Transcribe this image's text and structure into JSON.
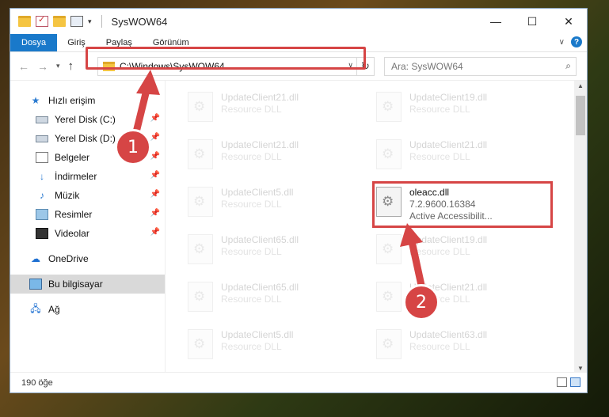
{
  "window": {
    "title": "SysWOW64"
  },
  "ribbon": {
    "tabs": [
      "Dosya",
      "Giriş",
      "Paylaş",
      "Görünüm"
    ],
    "help": "?"
  },
  "address": {
    "path": "C:\\Windows\\SysWOW64"
  },
  "search": {
    "placeholder": "Ara: SysWOW64"
  },
  "sidebar": {
    "items": [
      {
        "label": "Hızlı erişim",
        "icon": "star-icon"
      },
      {
        "label": "Yerel Disk (C:)",
        "icon": "disk-icon"
      },
      {
        "label": "Yerel Disk (D:)",
        "icon": "disk-icon"
      },
      {
        "label": "Belgeler",
        "icon": "documents-icon"
      },
      {
        "label": "İndirmeler",
        "icon": "download-icon"
      },
      {
        "label": "Müzik",
        "icon": "music-icon"
      },
      {
        "label": "Resimler",
        "icon": "pictures-icon"
      },
      {
        "label": "Videolar",
        "icon": "videos-icon"
      },
      {
        "label": "OneDrive",
        "icon": "cloud-icon"
      },
      {
        "label": "Bu bilgisayar",
        "icon": "computer-icon"
      },
      {
        "label": "Ağ",
        "icon": "network-icon"
      }
    ]
  },
  "files": [
    {
      "name": "UpdateClient21.dll",
      "desc": "Resource DLL"
    },
    {
      "name": "UpdateClient19.dll",
      "desc": "Resource DLL"
    },
    {
      "name": "UpdateClient21.dll",
      "desc": "Resource DLL"
    },
    {
      "name": "UpdateClient21.dll",
      "desc": "Resource DLL"
    },
    {
      "name": "UpdateClient5.dll",
      "desc": "Resource DLL"
    },
    {
      "name": "oleacc.dll",
      "version": "7.2.9600.16384",
      "desc": "Active Accessibilit..."
    },
    {
      "name": "UpdateClient65.dll",
      "desc": "Resource DLL"
    },
    {
      "name": "UpdateClient19.dll",
      "desc": "Resource DLL"
    },
    {
      "name": "UpdateClient65.dll",
      "desc": "Resource DLL"
    },
    {
      "name": "UpdateClient21.dll",
      "desc": "Resource DLL"
    },
    {
      "name": "UpdateClient5.dll",
      "desc": "Resource DLL"
    },
    {
      "name": "UpdateClient63.dll",
      "desc": "Resource DLL"
    }
  ],
  "status": {
    "count": "190 öğe"
  },
  "annotations": {
    "step1": "1",
    "step2": "2",
    "color": "#d64545"
  }
}
